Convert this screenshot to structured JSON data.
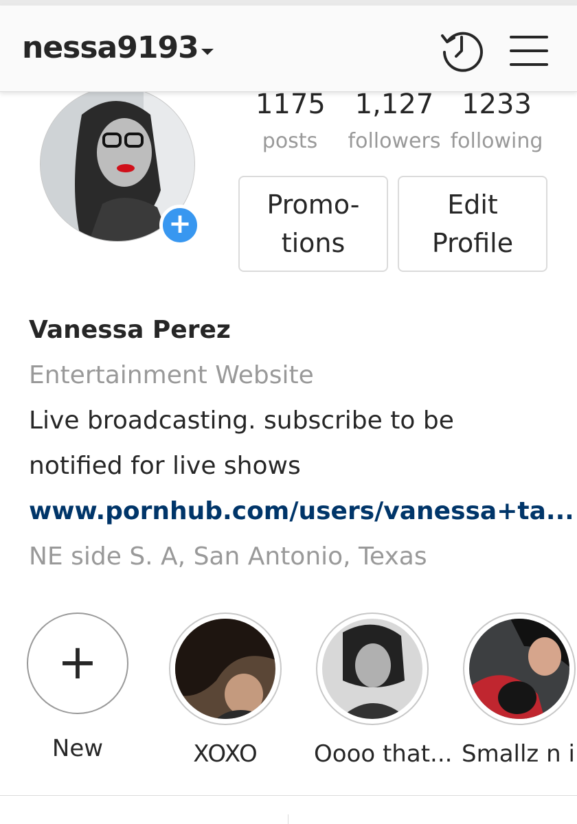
{
  "header": {
    "username": "nessa9193",
    "history_icon": "history-clock-icon",
    "menu_icon": "hamburger-menu-icon"
  },
  "profile": {
    "stats": [
      {
        "value": "1175",
        "label": "posts"
      },
      {
        "value": "1,127",
        "label": "followers"
      },
      {
        "value": "1233",
        "label": "following"
      }
    ],
    "buttons": {
      "promotions_line1": "Promo-",
      "promotions_line2": "tions",
      "edit_line1": "Edit",
      "edit_line2": "Profile"
    },
    "add_badge": "+"
  },
  "bio": {
    "name": "Vanessa Perez",
    "category": "Entertainment Website",
    "text_line1": "Live broadcasting. subscribe to be",
    "text_line2": "notified for live shows",
    "link": "www.pornhub.com/users/vanessa+ta...",
    "location": "NE side S. A, San Antonio, Texas"
  },
  "highlights": [
    {
      "label": "New",
      "symbol": "+"
    },
    {
      "label": "XOXO"
    },
    {
      "label": "Oooo that..."
    },
    {
      "label": "Smallz n i"
    }
  ],
  "colors": {
    "accent_blue": "#3897f0",
    "link": "#003569",
    "muted": "#999999",
    "text": "#262626"
  }
}
